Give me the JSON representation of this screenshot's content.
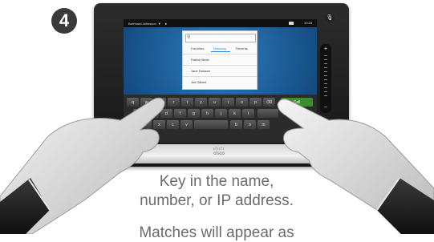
{
  "step": {
    "number": "4"
  },
  "status_bar": {
    "user": "Bernhard Johnsson",
    "caret": "▼",
    "menu_icon": "●",
    "time": "10:28"
  },
  "dialog": {
    "search_placeholder": "",
    "tabs": [
      {
        "label": "Favorites"
      },
      {
        "label": "Directory"
      },
      {
        "label": "Recents"
      }
    ],
    "entries": [
      {
        "name": "Patrick Bede"
      },
      {
        "name": "Jane Dawson"
      },
      {
        "name": "Jim Gilbert"
      }
    ]
  },
  "keyboard": {
    "row1": [
      "q",
      "w",
      "e",
      "r",
      "t",
      "y",
      "u",
      "i",
      "o",
      "p",
      "⌫"
    ],
    "row2": [
      "a",
      "s",
      "d",
      "f",
      "g",
      "h",
      "j",
      "k",
      "l"
    ],
    "row3": [
      "z",
      "x",
      "c",
      "v",
      "b",
      "n",
      "m"
    ],
    "call_label": "Call",
    "space_label": ""
  },
  "device": {
    "brand": "cisco",
    "brand_logo": "ılıılı"
  },
  "volume": {
    "plus": "+",
    "minus": "−"
  },
  "caption": {
    "line1": "Key in the name,",
    "line2": "number, or IP address.",
    "line3": "Matches will appear as"
  },
  "colors": {
    "screen_blue": "#1a5892",
    "call_green": "#3c8d2c",
    "caption_gray": "#6b6b6b"
  }
}
